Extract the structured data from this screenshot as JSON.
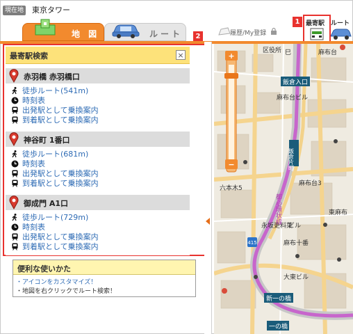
{
  "location": {
    "badge": "現在地",
    "name": "東京タワー"
  },
  "tabs": [
    {
      "label": "地 図",
      "active": true
    },
    {
      "label": "ルート",
      "active": false
    }
  ],
  "history_button": {
    "label": "履歴/My登録"
  },
  "station_button": {
    "label": "最寄駅"
  },
  "route_mini": {
    "label": "ルート"
  },
  "callouts": [
    "1",
    "2"
  ],
  "panel": {
    "title": "最寄駅検索",
    "close_label": "×",
    "stations": [
      {
        "name": "赤羽橋 赤羽橋口",
        "walk": "徒歩ルート(541m)",
        "timetable": "時刻表",
        "depart": "出発駅として乗換案内",
        "arrive": "到着駅として乗換案内"
      },
      {
        "name": "神谷町 1番口",
        "walk": "徒歩ルート(681m)",
        "timetable": "時刻表",
        "depart": "出発駅として乗換案内",
        "arrive": "到着駅として乗換案内"
      },
      {
        "name": "御成門 A1口",
        "walk": "徒歩ルート(729m)",
        "timetable": "時刻表",
        "depart": "出発駅として乗換案内",
        "arrive": "到着駅として乗換案内"
      }
    ]
  },
  "tips": {
    "title": "便利な使いかた",
    "line1": "・アイコンをカスタマイズ！",
    "line2": "・地図を右クリックでルート検索！"
  },
  "map": {
    "labels": {
      "dept": "区役所",
      "iikura_iriguchi": "飯倉入口",
      "iikura_kata": "飯倉片町",
      "azabudai3": "麻布台3",
      "roppongi5": "六本木5",
      "higashi_azabu": "東麻布",
      "nagasaka": "永坂更料菜",
      "azabu_juban": "麻布十番",
      "ohigashi_bldg": "大東ビル",
      "shin_ichinohashi": "新一の橋",
      "ichinohashi": "一の橋",
      "toshin_kanjo": "都心環状線",
      "route_num": "415",
      "building": "ビル",
      "azabudai": "麻布台",
      "shitennoji": "巳",
      "azabudai_c": "麻布台ビル"
    },
    "colors": {
      "route": "#c766cc",
      "road": "#f3d28a",
      "bg": "#efebe1",
      "block": "#d9cfbd",
      "slider": "#f28a2e"
    }
  }
}
